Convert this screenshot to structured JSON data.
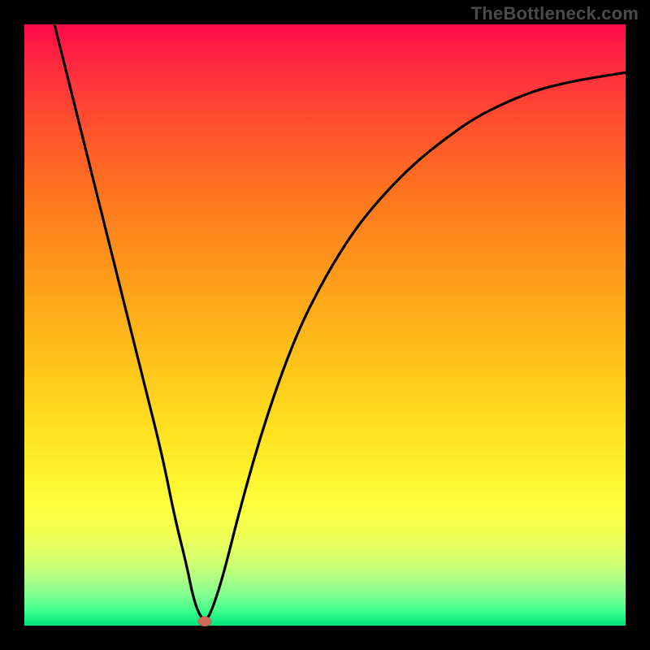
{
  "watermark": "TheBottleneck.com",
  "colors": {
    "marker_fill": "#d06b5a",
    "marker_stroke": "#a84e3e",
    "curve_stroke": "#000000"
  },
  "chart_data": {
    "type": "line",
    "title": "",
    "xlabel": "",
    "ylabel": "",
    "xlim": [
      0,
      100
    ],
    "ylim": [
      0,
      100
    ],
    "grid": false,
    "series": [
      {
        "name": "bottleneck-curve",
        "x": [
          5,
          8,
          11,
          14,
          17,
          20,
          23,
          25,
          27,
          28,
          29,
          30,
          31,
          33,
          36,
          40,
          45,
          50,
          55,
          60,
          65,
          70,
          75,
          80,
          85,
          90,
          95,
          100
        ],
        "y": [
          100,
          88,
          76,
          64,
          52,
          40,
          28,
          18,
          10,
          5,
          2,
          0.7,
          2,
          8,
          20,
          34,
          48,
          58,
          66,
          72,
          77,
          81,
          84.5,
          87,
          89,
          90.3,
          91.2,
          92
        ]
      }
    ],
    "annotations": [
      {
        "name": "optimal-point",
        "x": 30,
        "y": 0.7
      }
    ]
  }
}
